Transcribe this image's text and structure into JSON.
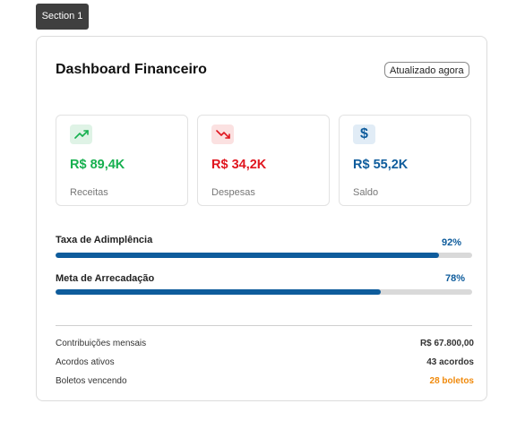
{
  "section_tag": "Section 1",
  "card": {
    "title": "Dashboard Financeiro",
    "updated_badge": "Atualizado agora"
  },
  "stats": [
    {
      "icon": "trending-up-icon",
      "value": "R$ 89,4K",
      "label": "Receitas",
      "color": "#16b04f"
    },
    {
      "icon": "trending-down-icon",
      "value": "R$ 34,2K",
      "label": "Despesas",
      "color": "#e0161f"
    },
    {
      "icon": "dollar-icon",
      "icon_glyph": "$",
      "value": "R$ 55,2K",
      "label": "Saldo",
      "color": "#0e5c9c"
    }
  ],
  "progress": [
    {
      "label": "Taxa de Adimplência",
      "percent_label": "92%",
      "percent": 92
    },
    {
      "label": "Meta de Arrecadação",
      "percent_label": "78%",
      "percent": 78
    }
  ],
  "details": [
    {
      "label": "Contribuições mensais",
      "value": "R$ 67.800,00",
      "color": "#333333"
    },
    {
      "label": "Acordos ativos",
      "value": "43 acordos",
      "color": "#333333"
    },
    {
      "label": "Boletos vencendo",
      "value": "28 boletos",
      "color": "#f08a0c"
    }
  ]
}
